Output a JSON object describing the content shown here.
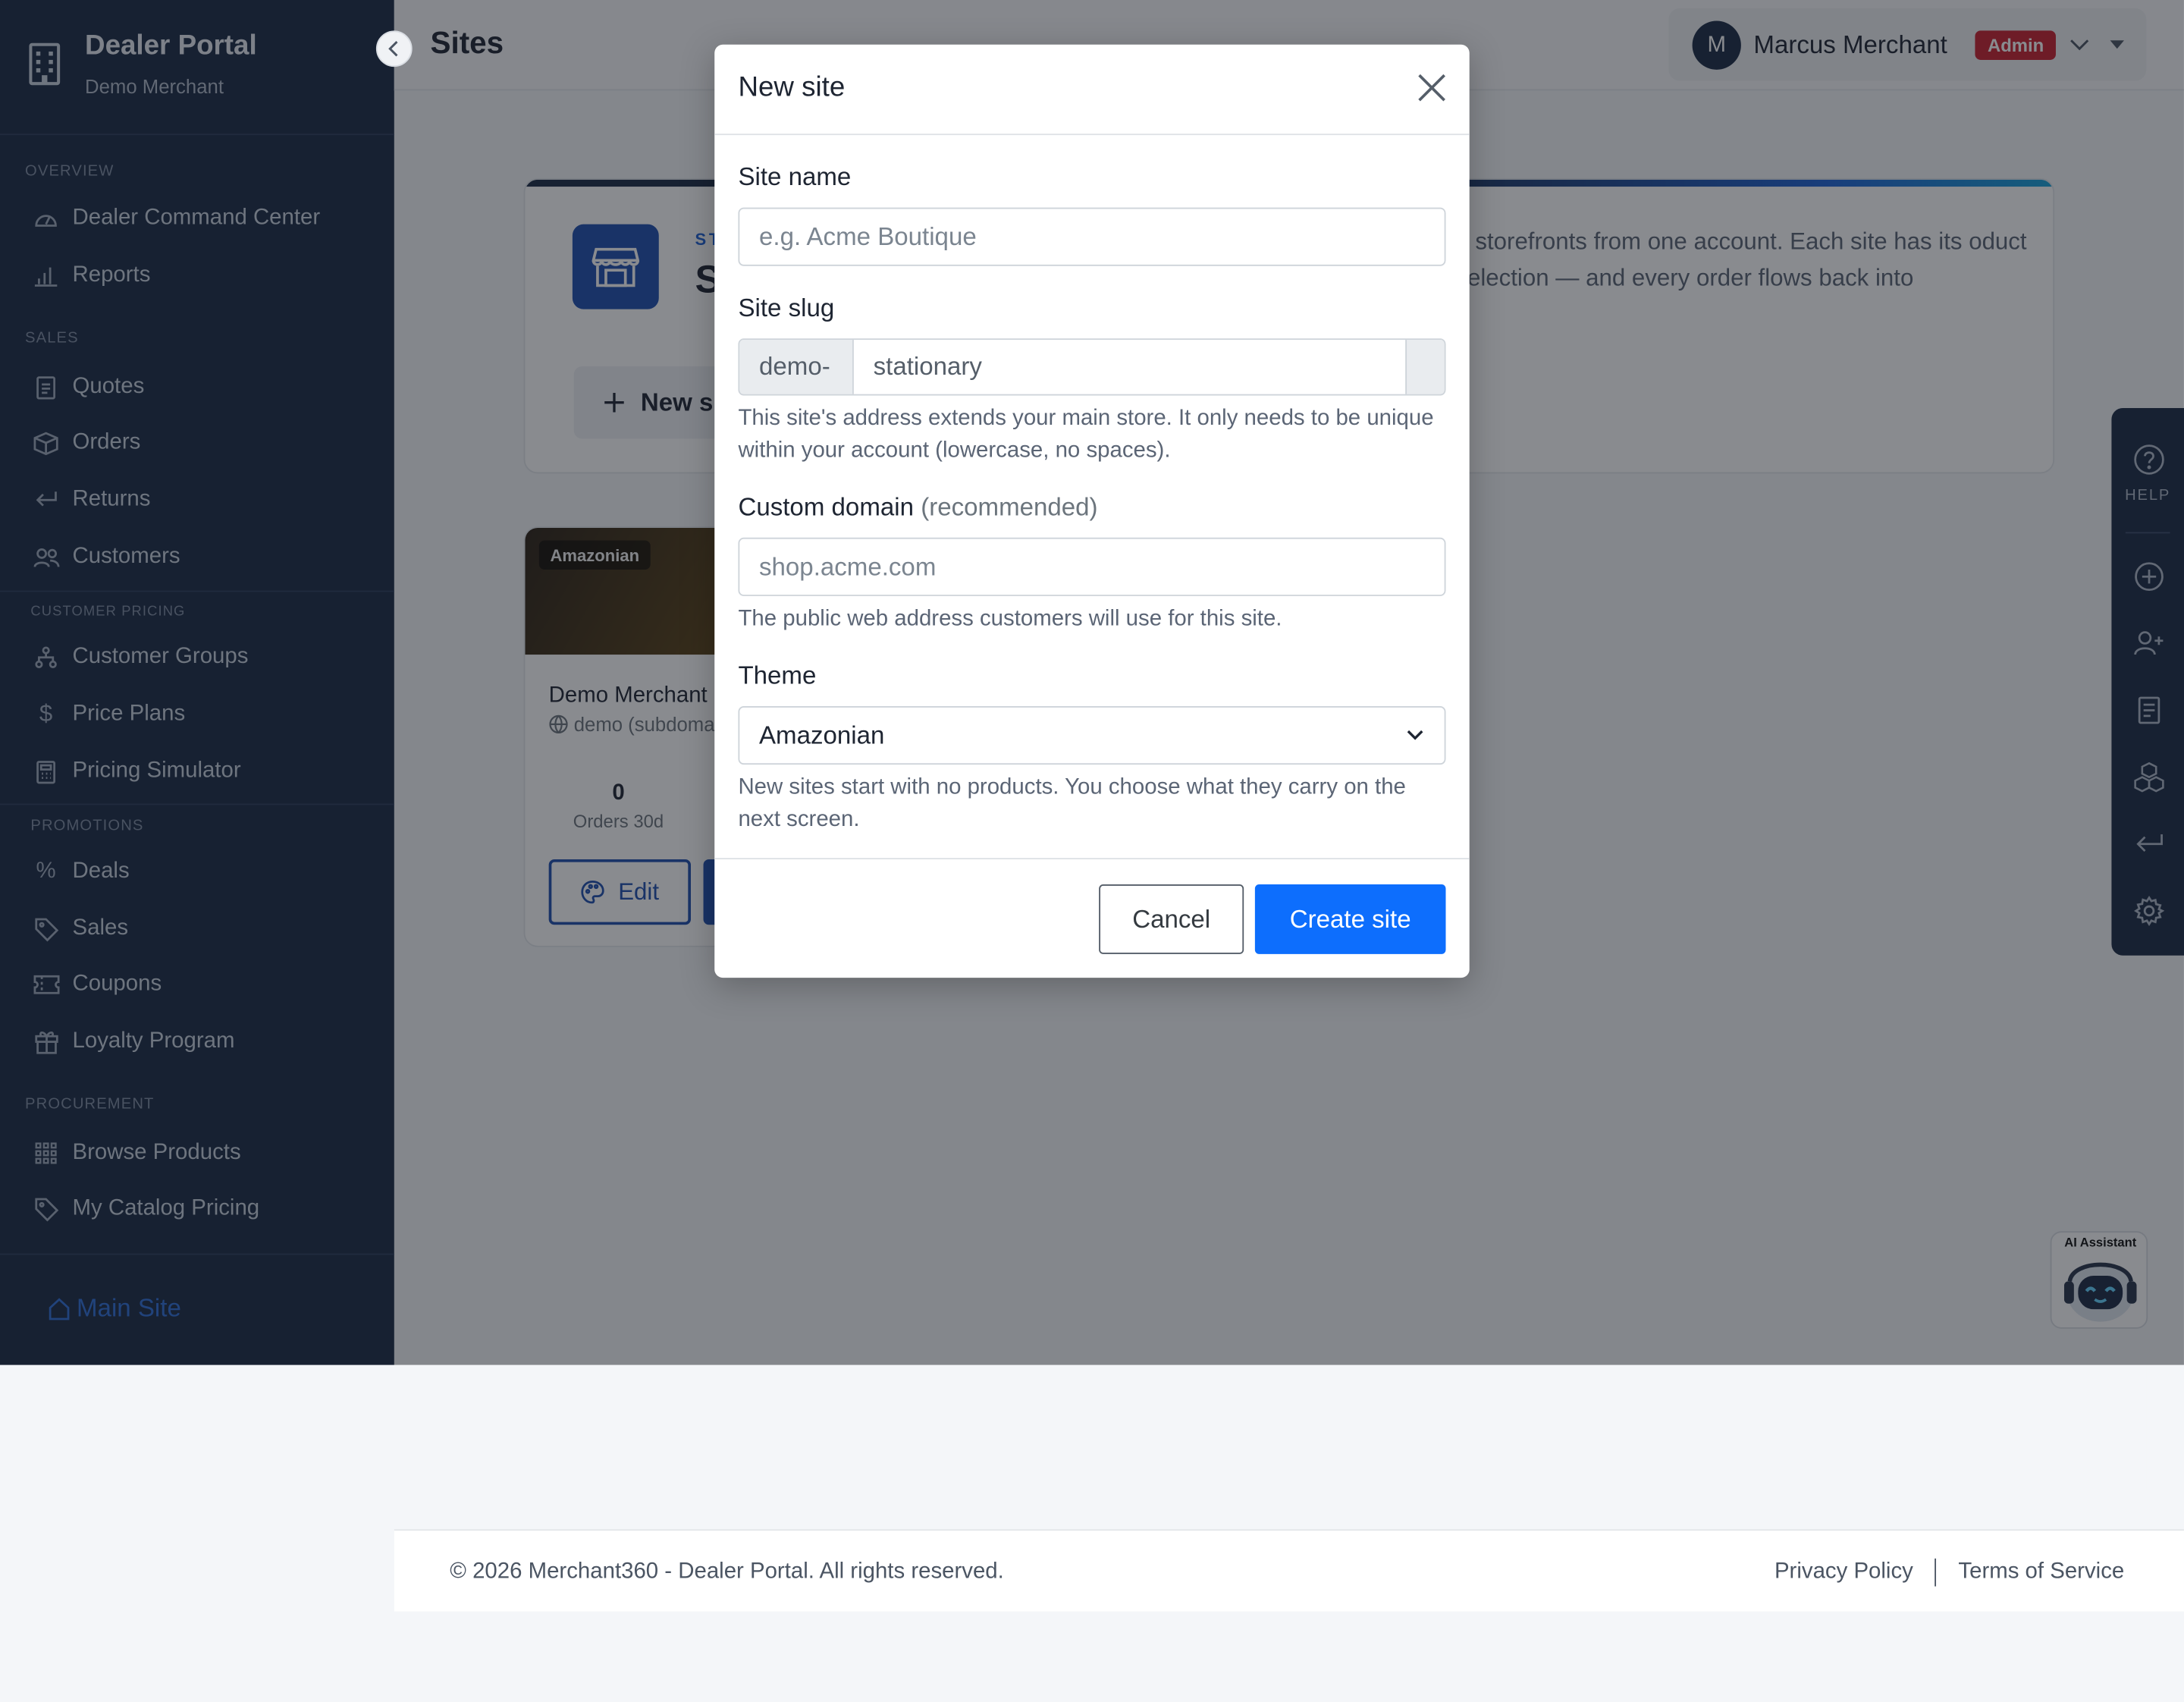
{
  "sidebar": {
    "brand_title": "Dealer Portal",
    "brand_subtitle": "Demo Merchant",
    "sections": {
      "overview": "OVERVIEW",
      "sales": "SALES",
      "customer_pricing": "CUSTOMER PRICING",
      "promotions": "PROMOTIONS",
      "procurement": "PROCUREMENT"
    },
    "items": {
      "dealer_command_center": "Dealer Command Center",
      "reports": "Reports",
      "quotes": "Quotes",
      "orders": "Orders",
      "returns": "Returns",
      "customers": "Customers",
      "customer_groups": "Customer Groups",
      "price_plans": "Price Plans",
      "pricing_simulator": "Pricing Simulator",
      "deals": "Deals",
      "sales": "Sales",
      "coupons": "Coupons",
      "loyalty_program": "Loyalty Program",
      "browse_products": "Browse Products",
      "my_catalog_pricing": "My Catalog Pricing"
    },
    "main_site": "Main Site"
  },
  "header": {
    "page_title": "Sites",
    "user_initial": "M",
    "user_name": "Marcus Merchant",
    "role_badge": "Admin"
  },
  "hero": {
    "kicker": "ST",
    "heading": "S",
    "description": "g storefronts from one account. Each site has its oduct selection — and every order flows back into",
    "new_site_button": "New s"
  },
  "site_card": {
    "theme_tag": "Amazonian",
    "name": "Demo Merchant",
    "subdomain": "demo (subdoma",
    "orders_30d_value": "0",
    "orders_30d_label": "Orders 30d",
    "edit_button": "Edit"
  },
  "right_rail": {
    "help_label": "HELP"
  },
  "ai_assistant": {
    "label": "AI Assistant"
  },
  "modal": {
    "title": "New site",
    "site_name": {
      "label": "Site name",
      "placeholder": "e.g. Acme Boutique",
      "value": ""
    },
    "site_slug": {
      "label": "Site slug",
      "prefix": "demo-",
      "value": "stationary",
      "help": "This site's address extends your main store. It only needs to be unique within your account (lowercase, no spaces)."
    },
    "custom_domain": {
      "label": "Custom domain",
      "label_suffix": "(recommended)",
      "placeholder": "shop.acme.com",
      "value": "",
      "help": "The public web address customers will use for this site."
    },
    "theme": {
      "label": "Theme",
      "selected": "Amazonian",
      "help": "New sites start with no products. You choose what they carry on the next screen."
    },
    "cancel_button": "Cancel",
    "create_button": "Create site"
  },
  "footer": {
    "copyright": "© 2026 Merchant360 - Dealer Portal. All rights reserved.",
    "privacy": "Privacy Policy",
    "terms": "Terms of Service"
  },
  "colors": {
    "sidebar_bg": "#1b2b45",
    "primary": "#0d6efd",
    "admin_badge": "#c8202f",
    "hero_icon": "#1f4fae"
  },
  "icons": {
    "brand": "building-icon",
    "close": "close-icon",
    "select": "chevron-down-icon"
  }
}
